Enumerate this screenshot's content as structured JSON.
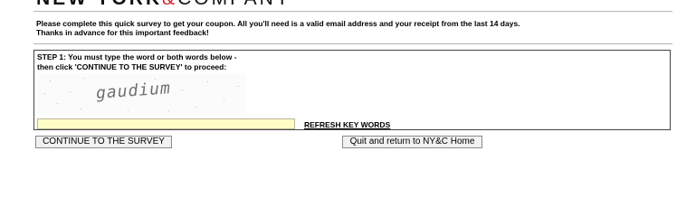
{
  "header": {
    "logo_part1": "NEW YORK",
    "logo_amp": "&",
    "logo_part2": "COMPANY"
  },
  "intro": {
    "line1": "Please complete this quick survey to get your coupon. All you'll need is a valid email address and your receipt from the last 14 days.",
    "line2": "Thanks in advance for this important feedback!"
  },
  "step1": {
    "instruction_line1": "STEP 1: You must type the word or both words below -",
    "instruction_line2": "then click 'CONTINUE TO THE SURVEY' to proceed:",
    "captcha_word": "gaudium",
    "answer_value": "",
    "refresh_label": "REFRESH KEY WORDS"
  },
  "buttons": {
    "continue_label": "CONTINUE TO THE SURVEY",
    "quit_label": "Quit and return to NY&C Home"
  },
  "colors": {
    "brand_red": "#d2232a",
    "input_bg": "#fffcc5"
  }
}
